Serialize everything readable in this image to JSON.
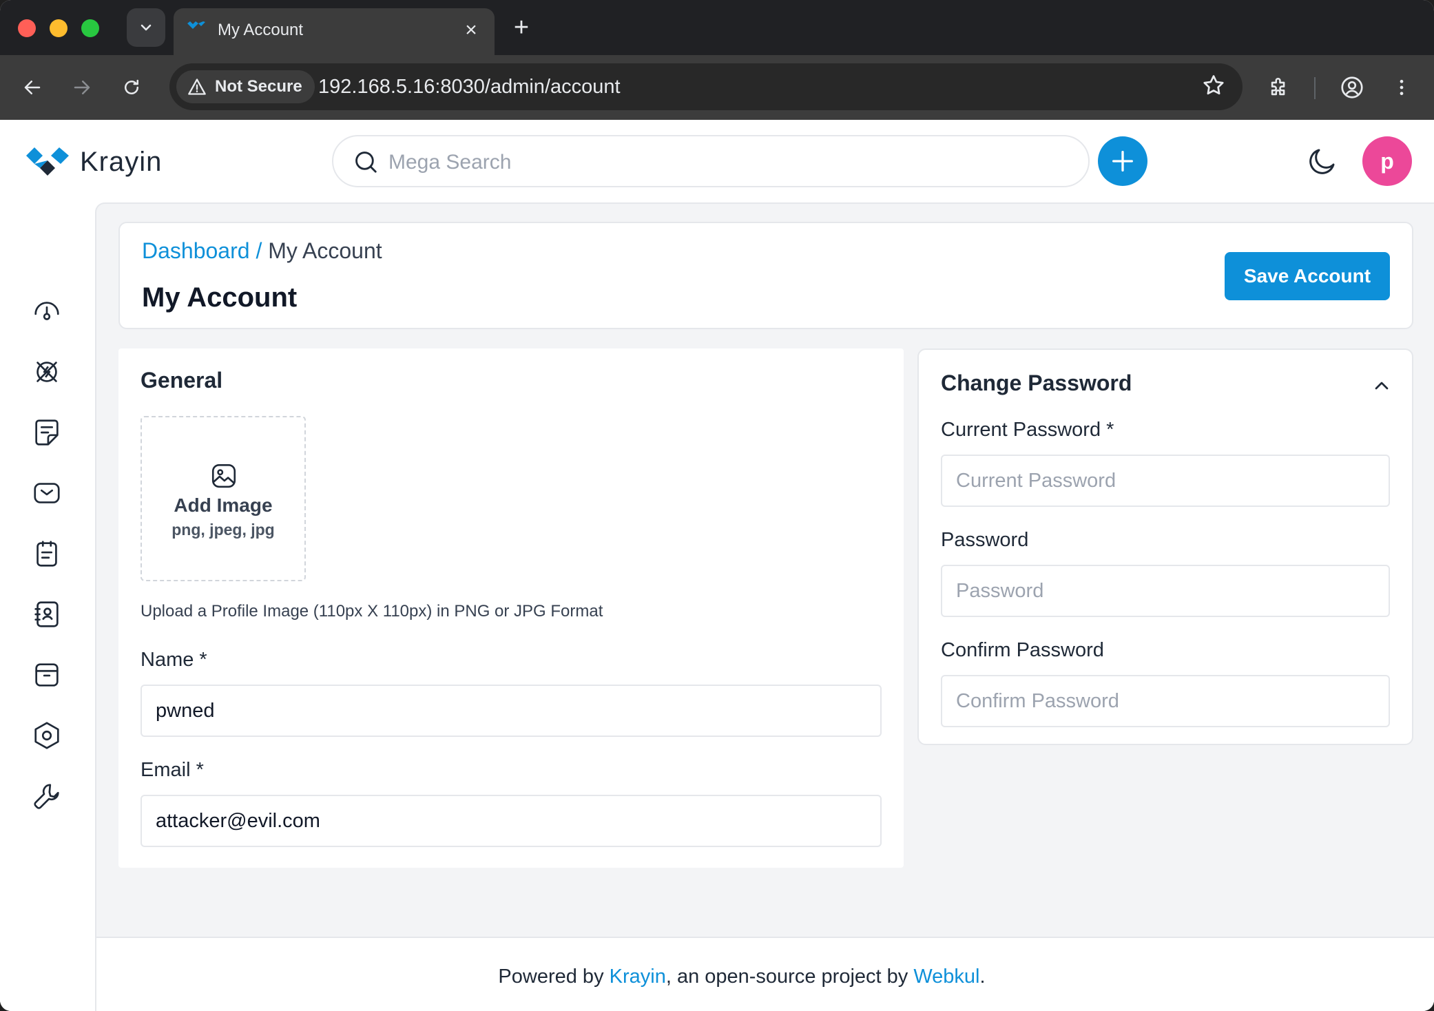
{
  "browser": {
    "tab_title": "My Account",
    "not_secure_label": "Not Secure",
    "url": "192.168.5.16:8030/admin/account"
  },
  "header": {
    "brand": "Krayin",
    "search_placeholder": "Mega Search",
    "avatar_initial": "p"
  },
  "sidebar": {
    "items": [
      {
        "icon": "dashboard-icon"
      },
      {
        "icon": "leads-icon"
      },
      {
        "icon": "quotes-icon"
      },
      {
        "icon": "mail-icon"
      },
      {
        "icon": "activities-icon"
      },
      {
        "icon": "contacts-icon"
      },
      {
        "icon": "products-icon"
      },
      {
        "icon": "settings-icon"
      },
      {
        "icon": "configuration-icon"
      }
    ]
  },
  "page": {
    "breadcrumb_link": "Dashboard",
    "breadcrumb_sep": " / ",
    "breadcrumb_current": "My Account",
    "title": "My Account",
    "save_label": "Save Account"
  },
  "general": {
    "title": "General",
    "add_image_label": "Add Image",
    "image_types": "png, jpeg, jpg",
    "upload_hint": "Upload a Profile Image (110px X 110px) in PNG or JPG Format",
    "name_label": "Name *",
    "name_value": "pwned",
    "email_label": "Email *",
    "email_value": "attacker@evil.com"
  },
  "password": {
    "title": "Change Password",
    "current_label": "Current Password *",
    "current_placeholder": "Current Password",
    "password_label": "Password",
    "password_placeholder": "Password",
    "confirm_label": "Confirm Password",
    "confirm_placeholder": "Confirm Password"
  },
  "footer": {
    "prefix": "Powered by ",
    "krayin_link": "Krayin",
    "middle": ", an open-source project by ",
    "webkul_link": "Webkul",
    "suffix": "."
  },
  "colors": {
    "accent": "#0e90d9",
    "avatar": "#ec4899"
  }
}
